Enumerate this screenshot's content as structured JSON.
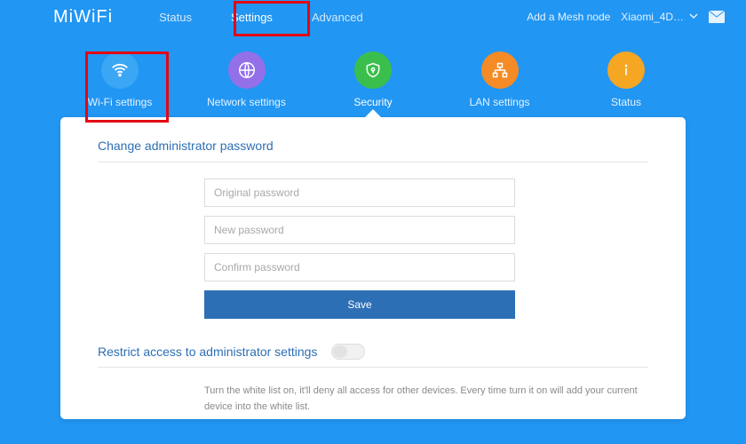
{
  "brand": "MiWiFi",
  "nav": {
    "status": "Status",
    "settings": "Settings",
    "advanced": "Advanced"
  },
  "header": {
    "add_mesh": "Add a Mesh node",
    "device": "Xiaomi_4D…"
  },
  "cats": {
    "wifi": "Wi-Fi settings",
    "network": "Network settings",
    "security": "Security",
    "lan": "LAN settings",
    "status": "Status"
  },
  "password": {
    "title": "Change administrator password",
    "ph_orig": "Original password",
    "ph_new": "New password",
    "ph_confirm": "Confirm password",
    "save": "Save"
  },
  "restrict": {
    "title": "Restrict access to administrator settings",
    "hint": "Turn the white list on, it'll deny all access for other devices. Every time turn it on will add your current device into the white list."
  }
}
